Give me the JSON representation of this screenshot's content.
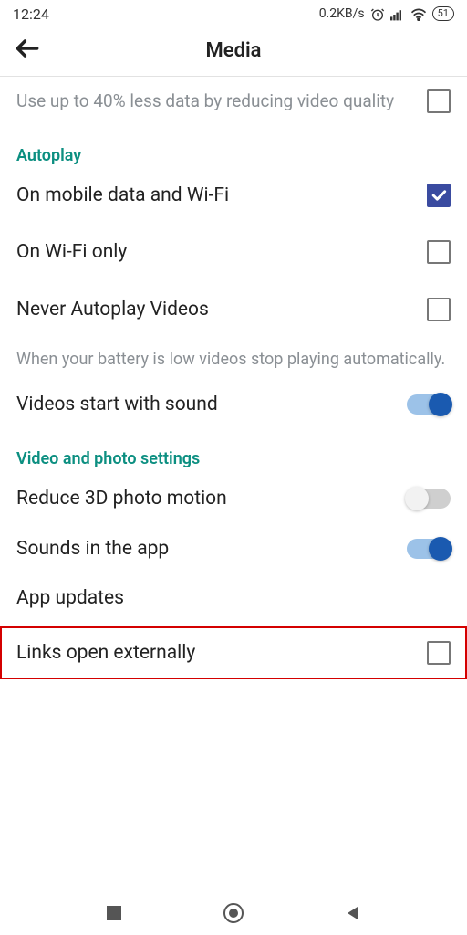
{
  "statusbar": {
    "time": "12:24",
    "data_rate": "0.2KB/s",
    "battery": "51"
  },
  "appbar": {
    "title": "Media"
  },
  "data_saver": {
    "label": "Use up to 40% less data by reducing video quality"
  },
  "sections": {
    "autoplay_title": "Autoplay",
    "video_photo_title": "Video and photo settings"
  },
  "autoplay": {
    "mobile_wifi": "On mobile data and Wi-Fi",
    "wifi_only": "On Wi-Fi only",
    "never": "Never Autoplay Videos",
    "helper": "When your battery is low videos stop playing automatically."
  },
  "settings": {
    "videos_sound": "Videos start with sound",
    "reduce_3d": "Reduce 3D photo motion",
    "sounds_in_app": "Sounds in the app",
    "app_updates": "App updates",
    "links_external": "Links open externally"
  }
}
